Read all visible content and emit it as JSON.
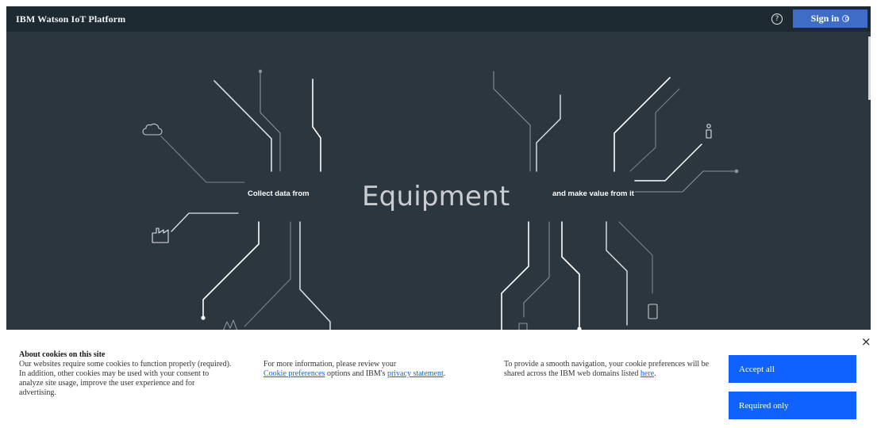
{
  "header": {
    "title": "IBM Watson IoT Platform",
    "help_icon": "question-circle-icon",
    "signin_label": "Sign in",
    "signin_icon": "user-circle-icon"
  },
  "hero": {
    "left_text": "Collect data from",
    "center_word": "Equipment",
    "right_text": "and make value from it",
    "icons": [
      "cloud-icon",
      "factory-icon",
      "person-sensor-icon",
      "mobile-phone-icon",
      "chip-icon",
      "airplane-icon"
    ],
    "colors": {
      "background": "#2c363e",
      "line": "#ffffff",
      "line_dim": "#7a8288"
    }
  },
  "cookie_banner": {
    "title": "About cookies on this site",
    "body": "Our websites require some cookies to function properly (required). In addition, other cookies may be used with your consent to analyze site usage, improve the user experience and for advertising.",
    "info_prefix": "For more information, please review your",
    "cookie_prefs_link": "Cookie preferences",
    "info_middle": "options and IBM's",
    "privacy_link": "privacy statement",
    "info_suffix": ".",
    "nav_text": "To provide a smooth navigation, your cookie preferences will be shared across the IBM web domains listed",
    "here_link": "here",
    "nav_suffix": ".",
    "accept_label": "Accept all",
    "required_label": "Required only",
    "close_label": "×",
    "colors": {
      "button": "#0f62fe",
      "link": "#0f62fe"
    }
  }
}
